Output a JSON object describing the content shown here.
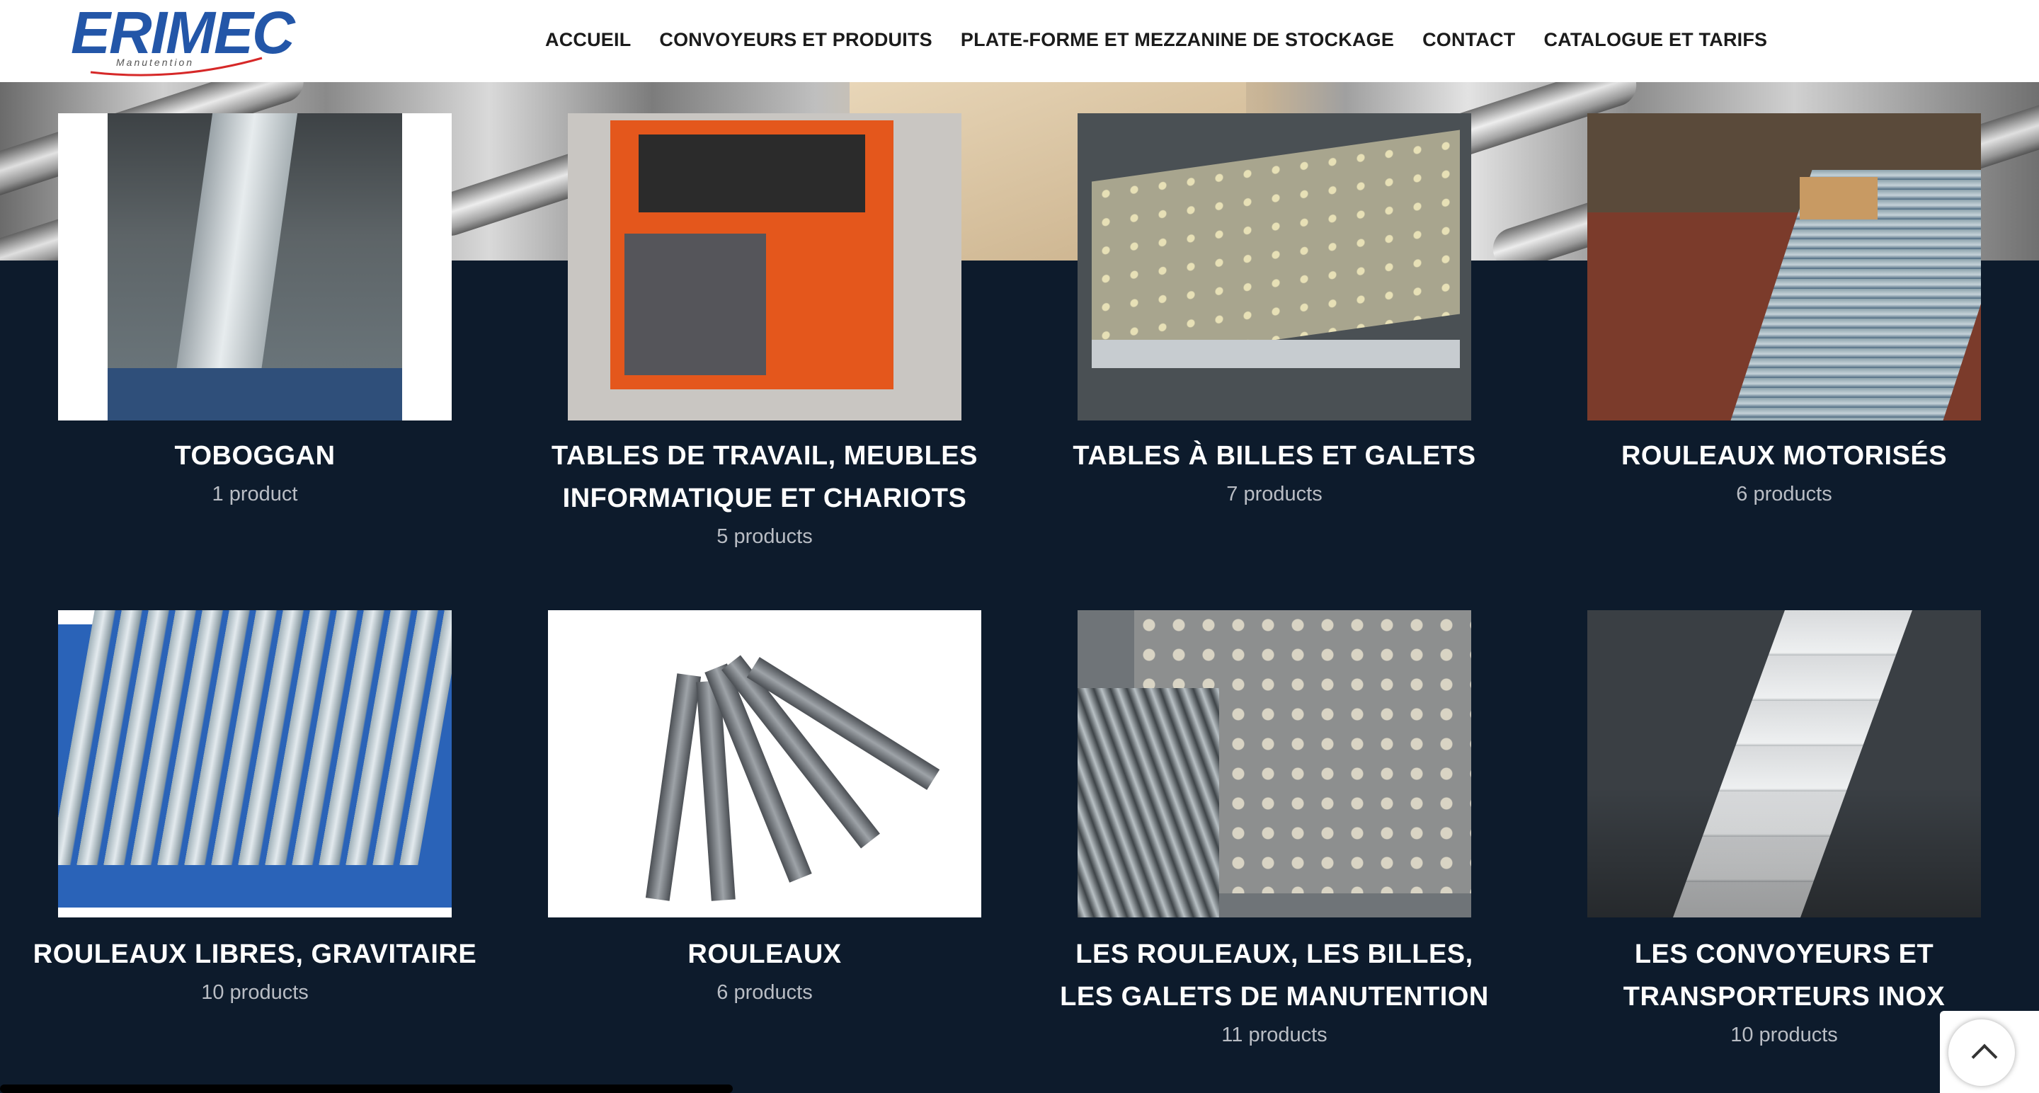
{
  "logo": {
    "text": "ERIMEC",
    "sub": "Manutention"
  },
  "nav": {
    "items": [
      "ACCUEIL",
      "CONVOYEURS ET PRODUITS",
      "PLATE-FORME ET MEZZANINE DE STOCKAGE",
      "CONTACT",
      "CATALOGUE ET TARIFS"
    ]
  },
  "categories": [
    {
      "title": "TOBOGGAN",
      "count": "1 product"
    },
    {
      "title": "TABLES DE TRAVAIL, MEUBLES INFORMATIQUE ET CHARIOTS",
      "count": "5 products"
    },
    {
      "title": "TABLES À BILLES ET GALETS",
      "count": "7 products"
    },
    {
      "title": "ROULEAUX MOTORISÉS",
      "count": "6 products"
    },
    {
      "title": "ROULEAUX LIBRES, GRAVITAIRE",
      "count": "10 products"
    },
    {
      "title": "ROULEAUX",
      "count": "6 products"
    },
    {
      "title": "LES ROULEAUX, LES BILLES, LES GALETS DE MANUTENTION",
      "count": "11 products"
    },
    {
      "title": "LES CONVOYEURS ET TRANSPORTEURS INOX",
      "count": "10 products"
    }
  ],
  "icons": {
    "scroll_top": "chevron-up-icon"
  }
}
